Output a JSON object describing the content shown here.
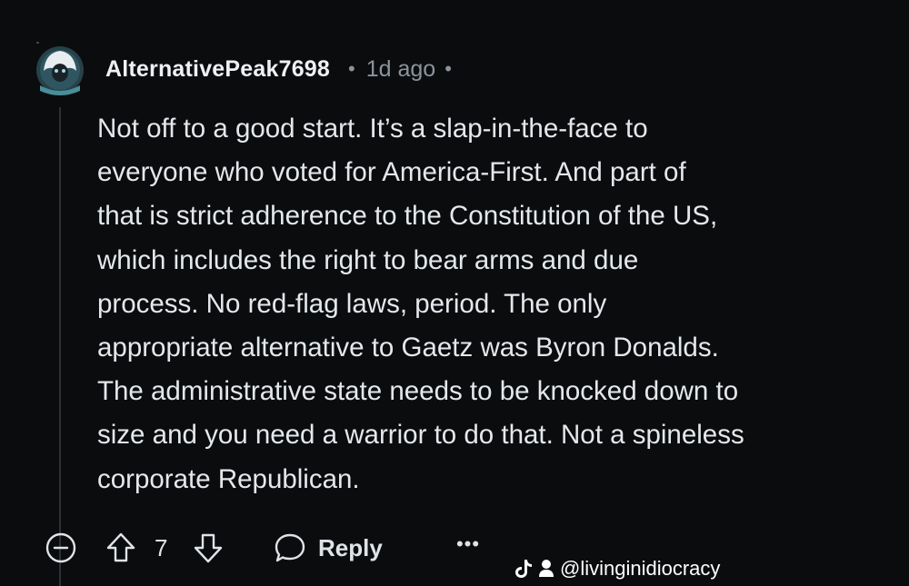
{
  "comment": {
    "author": "AlternativePeak7698",
    "separator": "•",
    "timestamp": "1d ago",
    "body_lines": [
      "Not off to a good start. It’s a slap-in-the-face to",
      "everyone who voted for America-First. And part of",
      "that is strict adherence to the Constitution of the US,",
      "which includes the right to bear arms and due",
      "process. No red-flag laws, period. The only",
      "appropriate alternative to Gaetz was Byron Donalds.",
      "The administrative state needs to be knocked down to",
      "size and you need a warrior to do that. Not a spineless",
      "corporate Republican."
    ]
  },
  "actions": {
    "collapse_icon": "minus-circle-icon",
    "upvote_icon": "arrow-up-icon",
    "vote_count": "7",
    "downvote_icon": "arrow-down-icon",
    "reply_icon": "speech-bubble-icon",
    "reply_label": "Reply",
    "more_label": "•••"
  },
  "watermark": {
    "platform_icon": "tiktok-icon",
    "user_icon": "person-icon",
    "handle": "@livinginidiocracy"
  },
  "colors": {
    "background": "#0b0c0e",
    "text": "#e4e8ec",
    "muted": "#8b949c",
    "thread_line": "#2d3237",
    "avatar_teal": "#5aa6b4"
  }
}
